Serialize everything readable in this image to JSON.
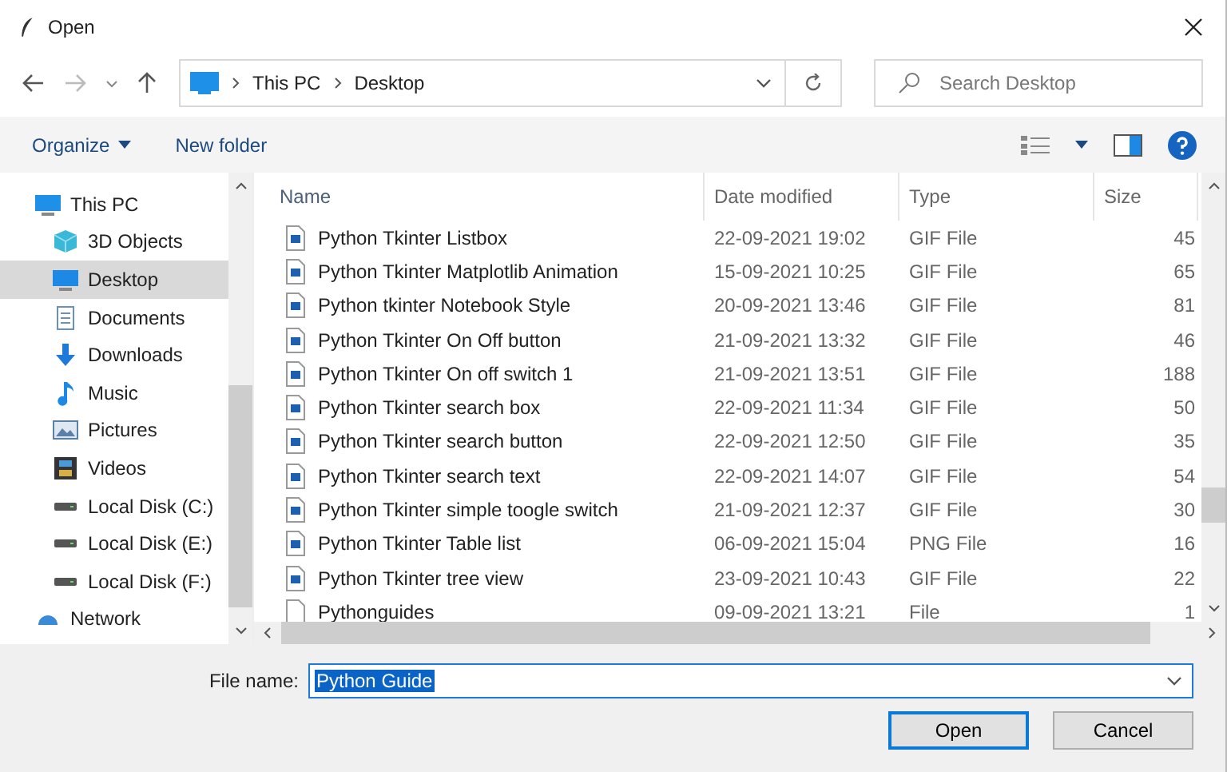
{
  "window": {
    "title": "Open"
  },
  "address": {
    "crumbs": [
      "This PC",
      "Desktop"
    ],
    "search_placeholder": "Search Desktop"
  },
  "toolbar": {
    "organize": "Organize",
    "new_folder": "New folder"
  },
  "sidebar": {
    "items": [
      {
        "label": "This PC",
        "kind": "pc",
        "selected": false,
        "children": [
          {
            "label": "3D Objects",
            "kind": "cube",
            "selected": false
          },
          {
            "label": "Desktop",
            "kind": "desktop",
            "selected": true
          },
          {
            "label": "Documents",
            "kind": "document",
            "selected": false
          },
          {
            "label": "Downloads",
            "kind": "download",
            "selected": false
          },
          {
            "label": "Music",
            "kind": "music",
            "selected": false
          },
          {
            "label": "Pictures",
            "kind": "picture",
            "selected": false
          },
          {
            "label": "Videos",
            "kind": "video",
            "selected": false
          },
          {
            "label": "Local Disk (C:)",
            "kind": "disk",
            "selected": false
          },
          {
            "label": "Local Disk (E:)",
            "kind": "disk",
            "selected": false
          },
          {
            "label": "Local Disk (F:)",
            "kind": "disk",
            "selected": false
          }
        ]
      },
      {
        "label": "Network",
        "kind": "network",
        "selected": false
      }
    ]
  },
  "table": {
    "columns": [
      "Name",
      "Date modified",
      "Type",
      "Size"
    ],
    "rows": [
      {
        "kind": "image",
        "name": "Python Tkinter Listbox",
        "date": "22-09-2021 19:02",
        "type": "GIF File",
        "size": "45"
      },
      {
        "kind": "image",
        "name": "Python Tkinter Matplotlib Animation",
        "date": "15-09-2021 10:25",
        "type": "GIF File",
        "size": "65"
      },
      {
        "kind": "image",
        "name": "Python tkinter Notebook Style",
        "date": "20-09-2021 13:46",
        "type": "GIF File",
        "size": "81"
      },
      {
        "kind": "image",
        "name": "Python Tkinter On Off button",
        "date": "21-09-2021 13:32",
        "type": "GIF File",
        "size": "46"
      },
      {
        "kind": "image",
        "name": "Python Tkinter On off switch 1",
        "date": "21-09-2021 13:51",
        "type": "GIF File",
        "size": "188"
      },
      {
        "kind": "image",
        "name": "Python Tkinter search box",
        "date": "22-09-2021 11:34",
        "type": "GIF File",
        "size": "50"
      },
      {
        "kind": "image",
        "name": "Python Tkinter search button",
        "date": "22-09-2021 12:50",
        "type": "GIF File",
        "size": "35"
      },
      {
        "kind": "image",
        "name": "Python Tkinter search text",
        "date": "22-09-2021 14:07",
        "type": "GIF File",
        "size": "54"
      },
      {
        "kind": "image",
        "name": "Python Tkinter simple toogle switch",
        "date": "21-09-2021 12:37",
        "type": "GIF File",
        "size": "30"
      },
      {
        "kind": "image",
        "name": "Python Tkinter Table list",
        "date": "06-09-2021 15:04",
        "type": "PNG File",
        "size": "16"
      },
      {
        "kind": "image",
        "name": "Python Tkinter tree view",
        "date": "23-09-2021 10:43",
        "type": "GIF File",
        "size": "22"
      },
      {
        "kind": "plain",
        "name": "Pythonguides",
        "date": "09-09-2021 13:21",
        "type": "File",
        "size": "1"
      }
    ]
  },
  "footer": {
    "file_name_label": "File name:",
    "file_name_value": "Python Guide",
    "buttons": [
      "Open",
      "Cancel"
    ]
  }
}
